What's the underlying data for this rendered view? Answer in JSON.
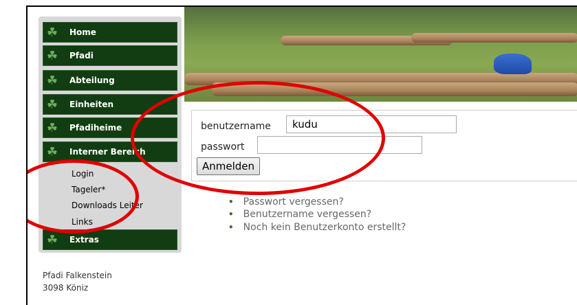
{
  "nav": {
    "items": [
      {
        "label": "Home"
      },
      {
        "label": "Pfadi"
      },
      {
        "label": "Abteilung"
      },
      {
        "label": "Einheiten"
      },
      {
        "label": "Pfadiheime"
      },
      {
        "label": "Interner Bereich"
      }
    ],
    "sub_items": [
      {
        "label": "Login"
      },
      {
        "label": "Tageler*"
      },
      {
        "label": "Downloads Leiter"
      },
      {
        "label": "Links"
      }
    ],
    "extras": {
      "label": "Extras"
    }
  },
  "address": {
    "line1": "Pfadi Falkenstein",
    "line2": "3098 Köniz"
  },
  "login": {
    "username_label": "benutzername",
    "username_value": "kudu",
    "password_label": "passwort",
    "password_value": "",
    "submit_label": "Anmelden"
  },
  "links": [
    {
      "label": "Passwort vergessen?"
    },
    {
      "label": "Benutzername vergessen?"
    },
    {
      "label": "Noch kein Benutzerkonto erstellt?"
    }
  ],
  "icons": {
    "menu": "clover-icon",
    "bullet": "bullet-icon"
  },
  "colors": {
    "menu_bg": "#123d12",
    "annotation": "#e00000"
  }
}
